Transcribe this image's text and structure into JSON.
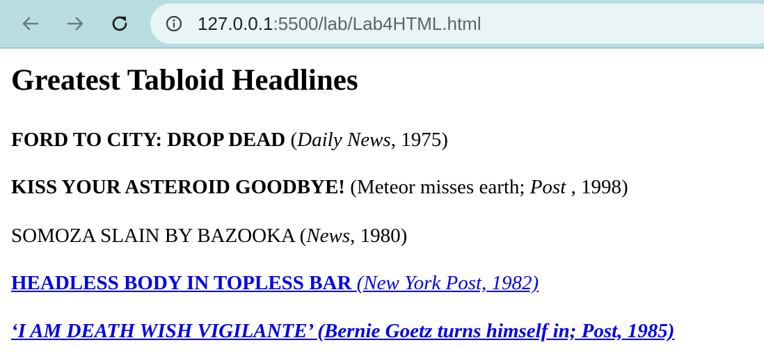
{
  "browser": {
    "url_host": "127.0.0.1",
    "url_path": ":5500/lab/Lab4HTML.html",
    "icons": [
      "back-arrow-icon",
      "forward-arrow-icon",
      "reload-icon",
      "info-icon"
    ]
  },
  "page": {
    "title": "Greatest Tabloid Headlines",
    "items": [
      {
        "headline": "FORD TO CITY: DROP DEAD",
        "open": " (",
        "source": "Daily News",
        "rest": ", 1975)"
      },
      {
        "headline": "KISS YOUR ASTEROID GOODBYE!",
        "open": " (Meteor misses earth; ",
        "source": "Post",
        "rest": " , 1998)"
      },
      {
        "headline": "SOMOZA SLAIN BY BAZOOKA",
        "open": " (",
        "source": "News",
        "rest": ", 1980)"
      },
      {
        "headline": "HEADLESS BODY IN TOPLESS BAR ",
        "source": "(New York Post, 1982)"
      },
      {
        "text": "‘I AM DEATH WISH VIGILANTE’ (Bernie Goetz turns himself in; Post, 1985)"
      }
    ]
  },
  "colors": {
    "toolbar": "#b8dde0",
    "omnibox": "#e8f4f5",
    "link": "#0000ee"
  }
}
